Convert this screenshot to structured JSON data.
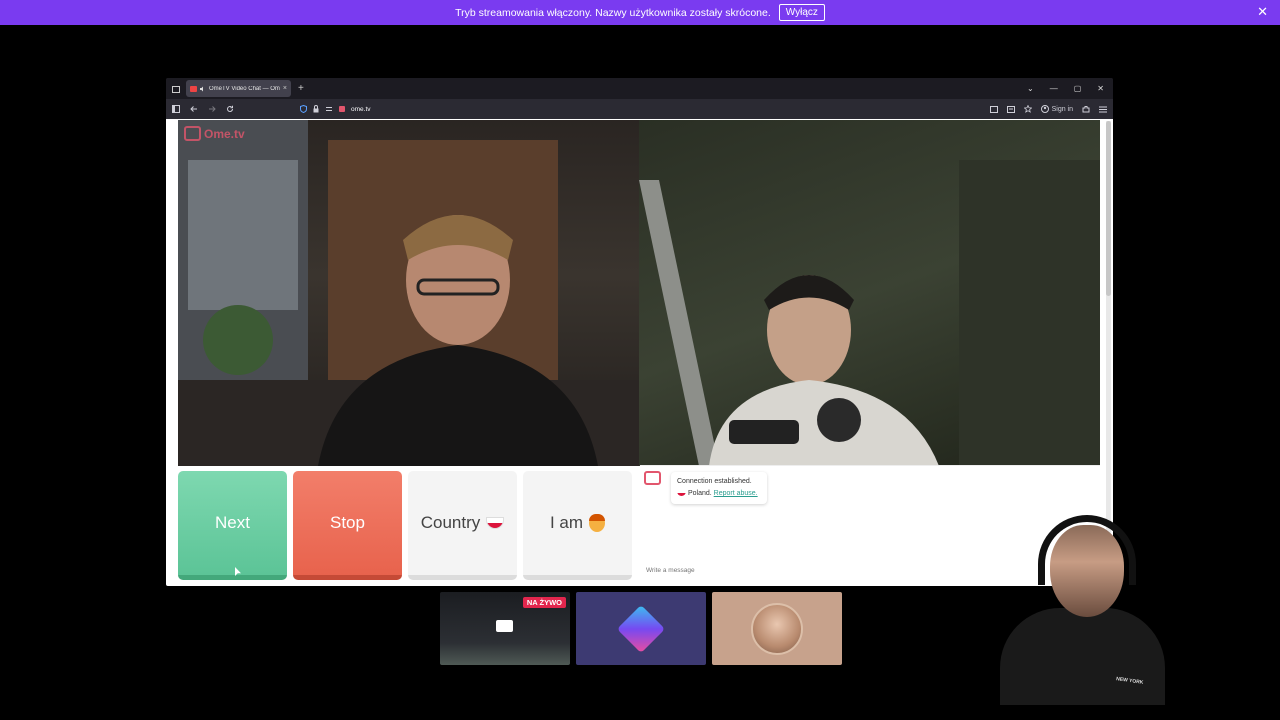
{
  "banner": {
    "message": "Tryb streamowania włączony. Nazwy użytkownika zostały skrócone.",
    "button_label": "Wyłącz",
    "close_glyph": "✕"
  },
  "browser": {
    "tab_title": "OmeTV Video Chat — Ome",
    "tab_close": "×",
    "new_tab": "+",
    "url": "ome.tv",
    "sign_in": "Sign in",
    "window_controls": [
      "⌄",
      "—",
      "▢",
      "✕"
    ]
  },
  "site": {
    "logo_text": "Ome.tv",
    "buttons": {
      "next": "Next",
      "stop": "Stop",
      "country": "Country",
      "iam": "I am"
    },
    "chat": {
      "status": "Connection established.",
      "country": "Poland.",
      "report": "Report abuse.",
      "input_placeholder": "Write a message"
    }
  },
  "previews": {
    "live_badge": "NA ŻYWO"
  },
  "webcam": {
    "shirt_text": "NEW YORK"
  },
  "colors": {
    "banner": "#7a3bf0",
    "next": "#6bd0a4",
    "stop": "#ee7059",
    "live": "#e2264d"
  }
}
